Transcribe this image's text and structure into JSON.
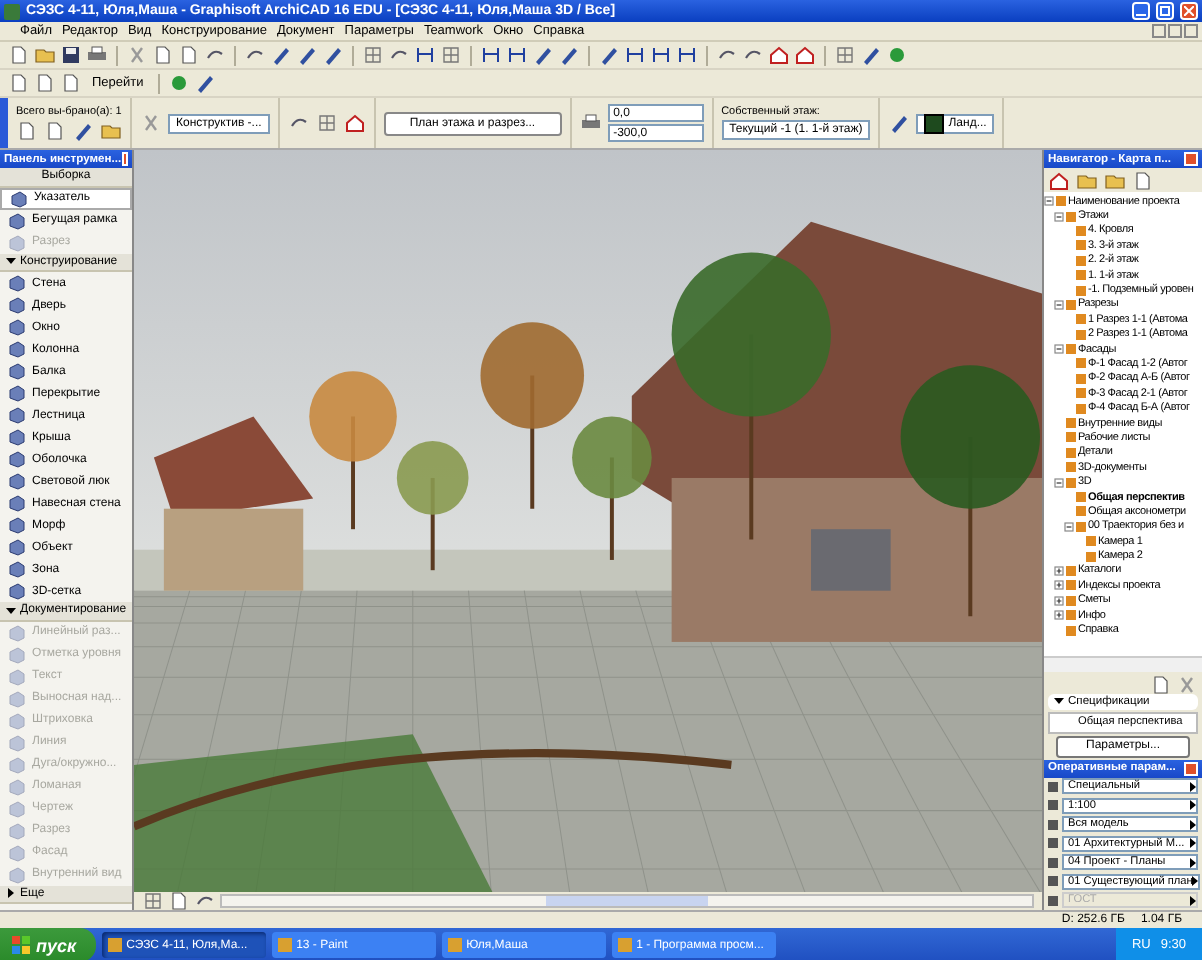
{
  "window": {
    "title": "СЭЗС 4-11, Юля,Маша - Graphisoft ArchiCAD 16 EDU - [СЭЗС 4-11, Юля,Маша 3D / Все]"
  },
  "menu": [
    "Файл",
    "Редактор",
    "Вид",
    "Конструирование",
    "Документ",
    "Параметры",
    "Teamwork",
    "Окно",
    "Справка"
  ],
  "toolbar": {
    "goto_label": "Перейти"
  },
  "info_box": {
    "selection_count": "Всего вы-брано(а): 1",
    "layer": "Конструктив -...",
    "view_button": "План этажа и разрез...",
    "x_value": "0,0",
    "y_value": "-300,0",
    "story_label": "Собственный этаж:",
    "story_value": "Текущий -1 (1. 1-й этаж)",
    "material": "Ланд..."
  },
  "toolbox": {
    "title": "Панель инструмен...",
    "sections": [
      {
        "title": "Выборка",
        "kind": "plain",
        "expanded": true,
        "items": [
          {
            "label": "Указатель",
            "selected": true,
            "disabled": false
          },
          {
            "label": "Бегущая рамка",
            "selected": false,
            "disabled": false
          },
          {
            "label": "Разрез",
            "selected": false,
            "disabled": true
          }
        ]
      },
      {
        "title": "Конструирование",
        "kind": "group",
        "expanded": true,
        "items": [
          {
            "label": "Стена",
            "selected": false,
            "disabled": false
          },
          {
            "label": "Дверь",
            "selected": false,
            "disabled": false
          },
          {
            "label": "Окно",
            "selected": false,
            "disabled": false
          },
          {
            "label": "Колонна",
            "selected": false,
            "disabled": false
          },
          {
            "label": "Балка",
            "selected": false,
            "disabled": false
          },
          {
            "label": "Перекрытие",
            "selected": false,
            "disabled": false
          },
          {
            "label": "Лестница",
            "selected": false,
            "disabled": false
          },
          {
            "label": "Крыша",
            "selected": false,
            "disabled": false
          },
          {
            "label": "Оболочка",
            "selected": false,
            "disabled": false
          },
          {
            "label": "Световой люк",
            "selected": false,
            "disabled": false
          },
          {
            "label": "Навесная стена",
            "selected": false,
            "disabled": false
          },
          {
            "label": "Морф",
            "selected": false,
            "disabled": false
          },
          {
            "label": "Объект",
            "selected": false,
            "disabled": false
          },
          {
            "label": "Зона",
            "selected": false,
            "disabled": false
          },
          {
            "label": "3D-сетка",
            "selected": false,
            "disabled": false
          }
        ]
      },
      {
        "title": "Документирование",
        "kind": "group",
        "expanded": true,
        "items": [
          {
            "label": "Линейный раз...",
            "selected": false,
            "disabled": true
          },
          {
            "label": "Отметка уровня",
            "selected": false,
            "disabled": true
          },
          {
            "label": "Текст",
            "selected": false,
            "disabled": true
          },
          {
            "label": "Выносная над...",
            "selected": false,
            "disabled": true
          },
          {
            "label": "Штриховка",
            "selected": false,
            "disabled": true
          },
          {
            "label": "Линия",
            "selected": false,
            "disabled": true
          },
          {
            "label": "Дуга/окружно...",
            "selected": false,
            "disabled": true
          },
          {
            "label": "Ломаная",
            "selected": false,
            "disabled": true
          },
          {
            "label": "Чертеж",
            "selected": false,
            "disabled": true
          },
          {
            "label": "Разрез",
            "selected": false,
            "disabled": true
          },
          {
            "label": "Фасад",
            "selected": false,
            "disabled": true
          },
          {
            "label": "Внутренний вид",
            "selected": false,
            "disabled": true
          }
        ]
      },
      {
        "title": "Еще",
        "kind": "group",
        "expanded": false
      }
    ]
  },
  "navigator": {
    "title": "Навигатор - Карта п...",
    "tree": [
      {
        "label": "Наименование проекта",
        "expanded": true,
        "selected": false,
        "children": [
          {
            "label": "Этажи",
            "expanded": true,
            "selected": false,
            "children": [
              {
                "label": "4. Кровля",
                "selected": false
              },
              {
                "label": "3. 3-й этаж",
                "selected": false
              },
              {
                "label": "2. 2-й этаж",
                "selected": false
              },
              {
                "label": "1. 1-й этаж",
                "selected": false
              },
              {
                "label": "-1. Подземный уровен",
                "selected": false
              }
            ]
          },
          {
            "label": "Разрезы",
            "expanded": true,
            "selected": false,
            "children": [
              {
                "label": "1 Разрез 1-1 (Автома",
                "selected": false
              },
              {
                "label": "2 Разрез 1-1 (Автома",
                "selected": false
              }
            ]
          },
          {
            "label": "Фасады",
            "expanded": true,
            "selected": false,
            "children": [
              {
                "label": "Ф-1 Фасад 1-2 (Автог",
                "selected": false
              },
              {
                "label": "Ф-2 Фасад А-Б (Автог",
                "selected": false
              },
              {
                "label": "Ф-3 Фасад 2-1 (Автог",
                "selected": false
              },
              {
                "label": "Ф-4 Фасад Б-А (Автог",
                "selected": false
              }
            ]
          },
          {
            "label": "Внутренние виды",
            "selected": false
          },
          {
            "label": "Рабочие листы",
            "selected": false
          },
          {
            "label": "Детали",
            "selected": false
          },
          {
            "label": "3D-документы",
            "selected": false
          },
          {
            "label": "3D",
            "expanded": true,
            "selected": false,
            "children": [
              {
                "label": "Общая перспектив",
                "selected": true
              },
              {
                "label": "Общая аксонометри",
                "selected": false
              },
              {
                "label": "00 Траектория без и",
                "expanded": true,
                "selected": false,
                "children": [
                  {
                    "label": "Камера 1",
                    "selected": false
                  },
                  {
                    "label": "Камера 2",
                    "selected": false
                  }
                ]
              }
            ]
          },
          {
            "label": "Каталоги",
            "expanded": false,
            "selected": false
          },
          {
            "label": "Индексы проекта",
            "expanded": false,
            "selected": false
          },
          {
            "label": "Сметы",
            "expanded": false,
            "selected": false
          },
          {
            "label": "Инфо",
            "expanded": false,
            "selected": false
          },
          {
            "label": "Справка",
            "selected": false
          }
        ]
      }
    ],
    "specs_label": "Спецификации",
    "view_name": "Общая перспектива",
    "params_button": "Параметры..."
  },
  "quick_options": {
    "title": "Оперативные парам...",
    "dropdowns": [
      {
        "value": "Специальный",
        "disabled": false
      },
      {
        "value": "1:100",
        "disabled": false
      },
      {
        "value": "Вся модель",
        "disabled": false
      },
      {
        "value": "01 Архитектурный М...",
        "disabled": false
      },
      {
        "value": "04 Проект - Планы",
        "disabled": false
      },
      {
        "value": "01 Существующий план",
        "disabled": false
      },
      {
        "value": "ГОСТ",
        "disabled": true
      }
    ]
  },
  "status_bar": {
    "disk": "D: 252.6 ГБ",
    "memory": "1.04 ГБ"
  },
  "taskbar": {
    "start": "пуск",
    "tasks": [
      {
        "label": "СЭЗС 4-11, Юля,Ма...",
        "selected": true
      },
      {
        "label": "13 - Paint",
        "selected": false
      },
      {
        "label": "Юля,Маша",
        "selected": false
      },
      {
        "label": "1 - Программа просм...",
        "selected": false
      }
    ],
    "language": "RU",
    "clock": "9:30"
  }
}
